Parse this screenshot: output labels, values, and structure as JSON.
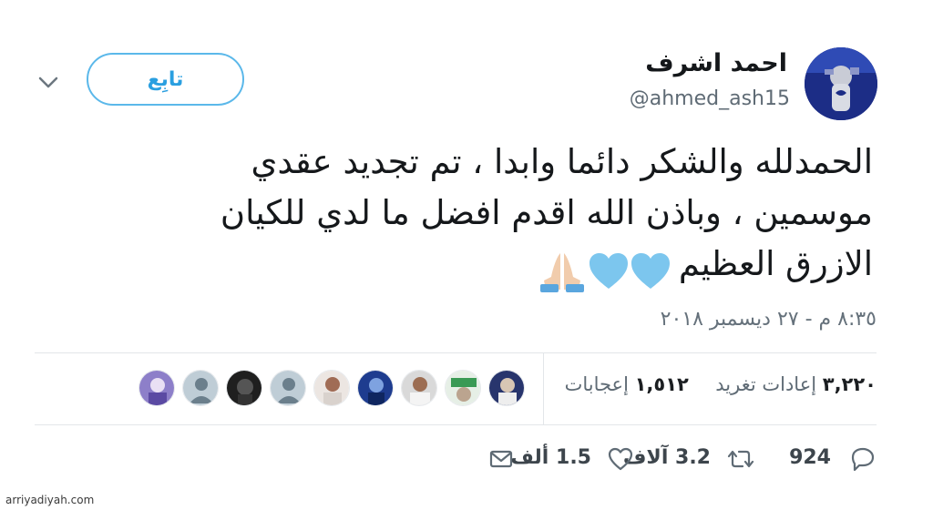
{
  "author": {
    "display_name": "احمد اشرف",
    "handle": "@ahmed_ash15"
  },
  "follow_button": {
    "label": "تابِع"
  },
  "tweet": {
    "lines": [
      "الحمدلله والشكر دائما وابدا ، تم تجديد عقدي",
      "موسمين  ، وباذن الله اقدم افضل ما لدي للكيان",
      "الازرق العظيم"
    ],
    "emojis": [
      "blue-heart",
      "blue-heart",
      "folded-hands"
    ],
    "timestamp": "٨:٣٥ م - ٢٧ ديسمبر ٢٠١٨"
  },
  "stats": {
    "retweets_count": "٣,٢٢٠",
    "retweets_label": "إعادات تغريد",
    "likes_count": "١,٥١٢",
    "likes_label": "إعجابات"
  },
  "actions": {
    "reply_count": "924",
    "retweet_count": "3.2 آلاف",
    "like_count": "1.5 ألف"
  },
  "watermark": "arriyadiyah.com",
  "colors": {
    "accent": "#2a9fe0",
    "follow_border": "#5bb8ea",
    "muted_text": "#5f6b75",
    "heart_blue": "#7cc6ee",
    "divider": "#e3e6e9"
  }
}
